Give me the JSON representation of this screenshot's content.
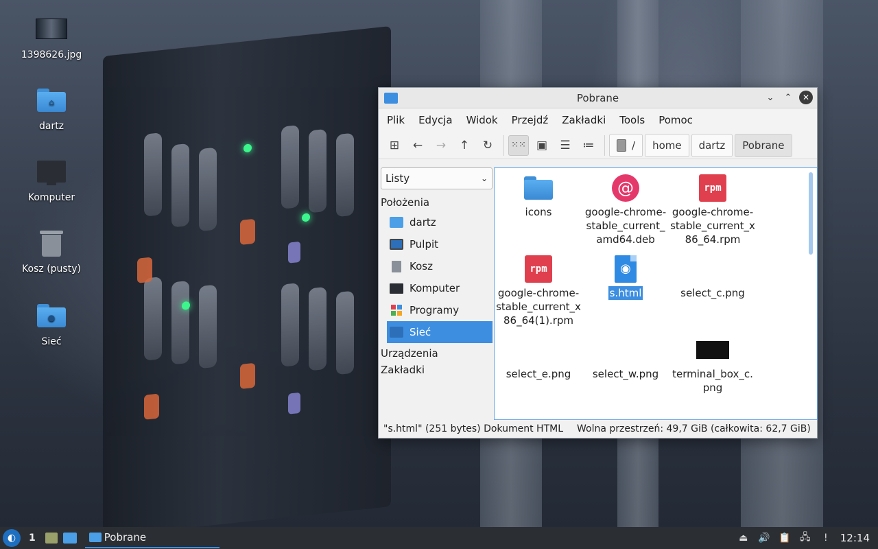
{
  "desktop": {
    "icons": [
      {
        "label": "1398626.jpg",
        "icon": "image-file-icon"
      },
      {
        "label": "dartz",
        "icon": "home-folder-icon"
      },
      {
        "label": "Komputer",
        "icon": "computer-icon"
      },
      {
        "label": "Kosz (pusty)",
        "icon": "trash-icon"
      },
      {
        "label": "Sieć",
        "icon": "network-folder-icon"
      }
    ]
  },
  "window": {
    "title": "Pobrane",
    "menu": [
      "Plik",
      "Edycja",
      "Widok",
      "Przejdź",
      "Zakładki",
      "Tools",
      "Pomoc"
    ],
    "breadcrumb": {
      "root": "/",
      "items": [
        "home",
        "dartz",
        "Pobrane"
      ]
    },
    "sidebar": {
      "mode": "Listy",
      "places_header": "Położenia",
      "places": [
        {
          "label": "dartz",
          "icon": "home-folder-icon"
        },
        {
          "label": "Pulpit",
          "icon": "desktop-folder-icon"
        },
        {
          "label": "Kosz",
          "icon": "trash-icon"
        },
        {
          "label": "Komputer",
          "icon": "computer-icon"
        },
        {
          "label": "Programy",
          "icon": "applications-icon"
        },
        {
          "label": "Sieć",
          "icon": "network-icon",
          "selected": true
        }
      ],
      "devices_header": "Urządzenia",
      "bookmarks_header": "Zakładki"
    },
    "files": [
      {
        "name": "icons",
        "icon": "folder-icon"
      },
      {
        "name": "google-chrome-stable_current_amd64.deb",
        "icon": "debian-package-icon"
      },
      {
        "name": "google-chrome-stable_current_x86_64.rpm",
        "icon": "rpm-package-icon"
      },
      {
        "name": "google-chrome-stable_current_x86_64(1).rpm",
        "icon": "rpm-package-icon"
      },
      {
        "name": "s.html",
        "icon": "html-file-icon",
        "selected": true
      },
      {
        "name": "select_c.png",
        "icon": "image-file-icon"
      },
      {
        "name": "select_e.png",
        "icon": "image-file-icon"
      },
      {
        "name": "select_w.png",
        "icon": "image-file-icon"
      },
      {
        "name": "terminal_box_c.png",
        "icon": "image-file-icon"
      }
    ],
    "status": {
      "selection": "\"s.html\" (251 bytes) Dokument HTML",
      "free_space": "Wolna przestrzeń: 49,7 GiB (całkowita: 62,7 GiB)"
    }
  },
  "taskbar": {
    "desktop_number": "1",
    "window_button": "Pobrane",
    "clock": "12:14"
  },
  "colors": {
    "accent": "#3d8ee0",
    "taskbar": "#2b2e33",
    "folder": "#4a9fe6",
    "rpm": "#e0404e",
    "debian": "#e5386a"
  }
}
